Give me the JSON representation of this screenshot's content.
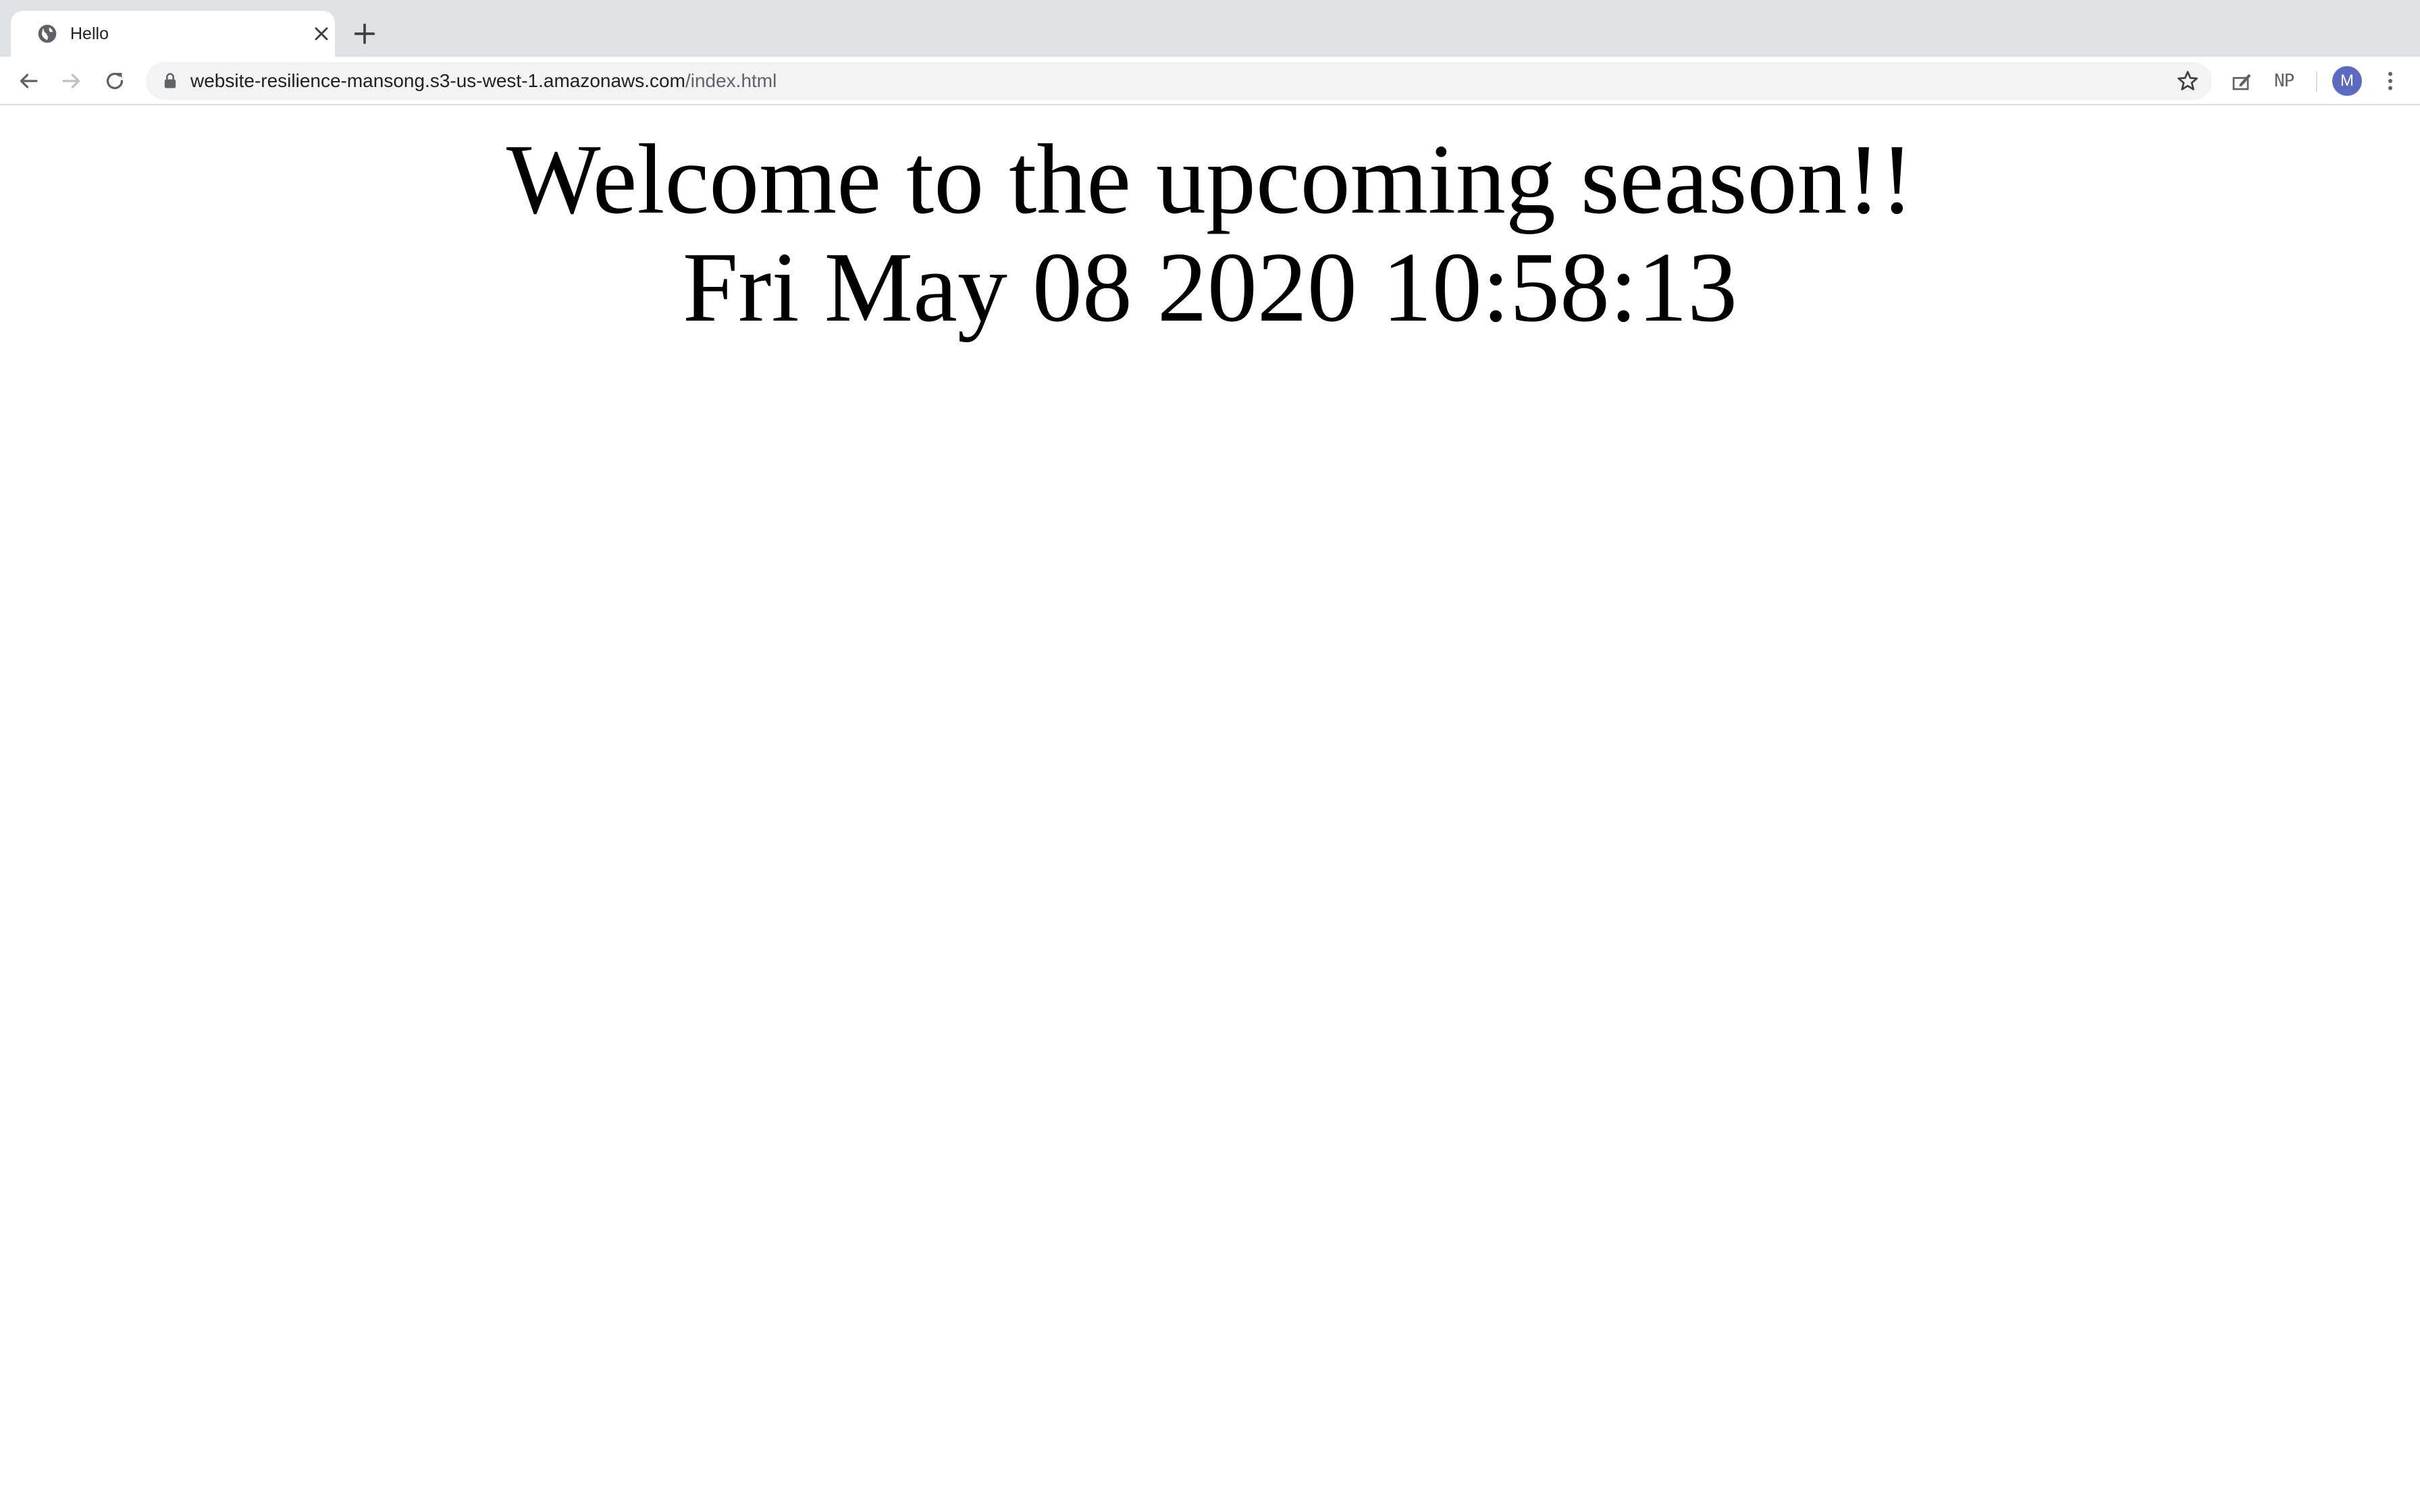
{
  "browser": {
    "tab": {
      "title": "Hello",
      "favicon": "globe-icon"
    },
    "icons": {
      "back": "arrow-left-icon",
      "forward": "arrow-right-icon",
      "reload": "reload-icon",
      "lock": "lock-icon",
      "bookmark": "star-icon",
      "extension": "edit-extension-icon",
      "menu": "kebab-menu-icon",
      "new_tab": "plus-icon",
      "close_tab": "close-icon"
    },
    "url": {
      "host": "website-resilience-mansong.s3-us-west-1.amazonaws.com",
      "path": "/index.html"
    },
    "extension_label": "NP",
    "profile_initial": "M",
    "colors": {
      "tabstrip_bg": "#dee1e6",
      "omnibox_bg": "#f1f3f4",
      "avatar_bg": "#5c6bc0"
    }
  },
  "page": {
    "headline": "Welcome to the upcoming season!!",
    "datetime": "Fri May 08 2020 10:58:13"
  }
}
